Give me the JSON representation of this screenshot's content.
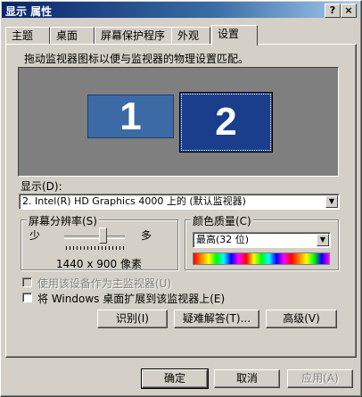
{
  "window": {
    "title": "显示 属性",
    "help_button": "?",
    "close_button": "×"
  },
  "tabs": [
    "主题",
    "桌面",
    "屏幕保护程序",
    "外观",
    "设置"
  ],
  "settings": {
    "instruction": "拖动监视器图标以便与监视器的物理设置匹配。",
    "monitors": [
      "1",
      "2"
    ],
    "display_label": "显示(D):",
    "display_value": "2. Intel(R) HD Graphics 4000 上的 (默认监视器)",
    "resolution_group": "屏幕分辨率(S)",
    "resolution_less": "少",
    "resolution_more": "多",
    "resolution_value": "1440 x 900 像素",
    "color_group": "颜色质量(C)",
    "color_value": "最高(32 位)",
    "primary_checkbox": "使用该设备作为主监视器(U)",
    "extend_checkbox": "将 Windows 桌面扩展到该监视器上(E)",
    "identify_button": "识别(I)",
    "troubleshoot_button": "疑难解答(T)...",
    "advanced_button": "高级(V)"
  },
  "footer": {
    "ok": "确定",
    "cancel": "取消",
    "apply": "应用(A)"
  }
}
